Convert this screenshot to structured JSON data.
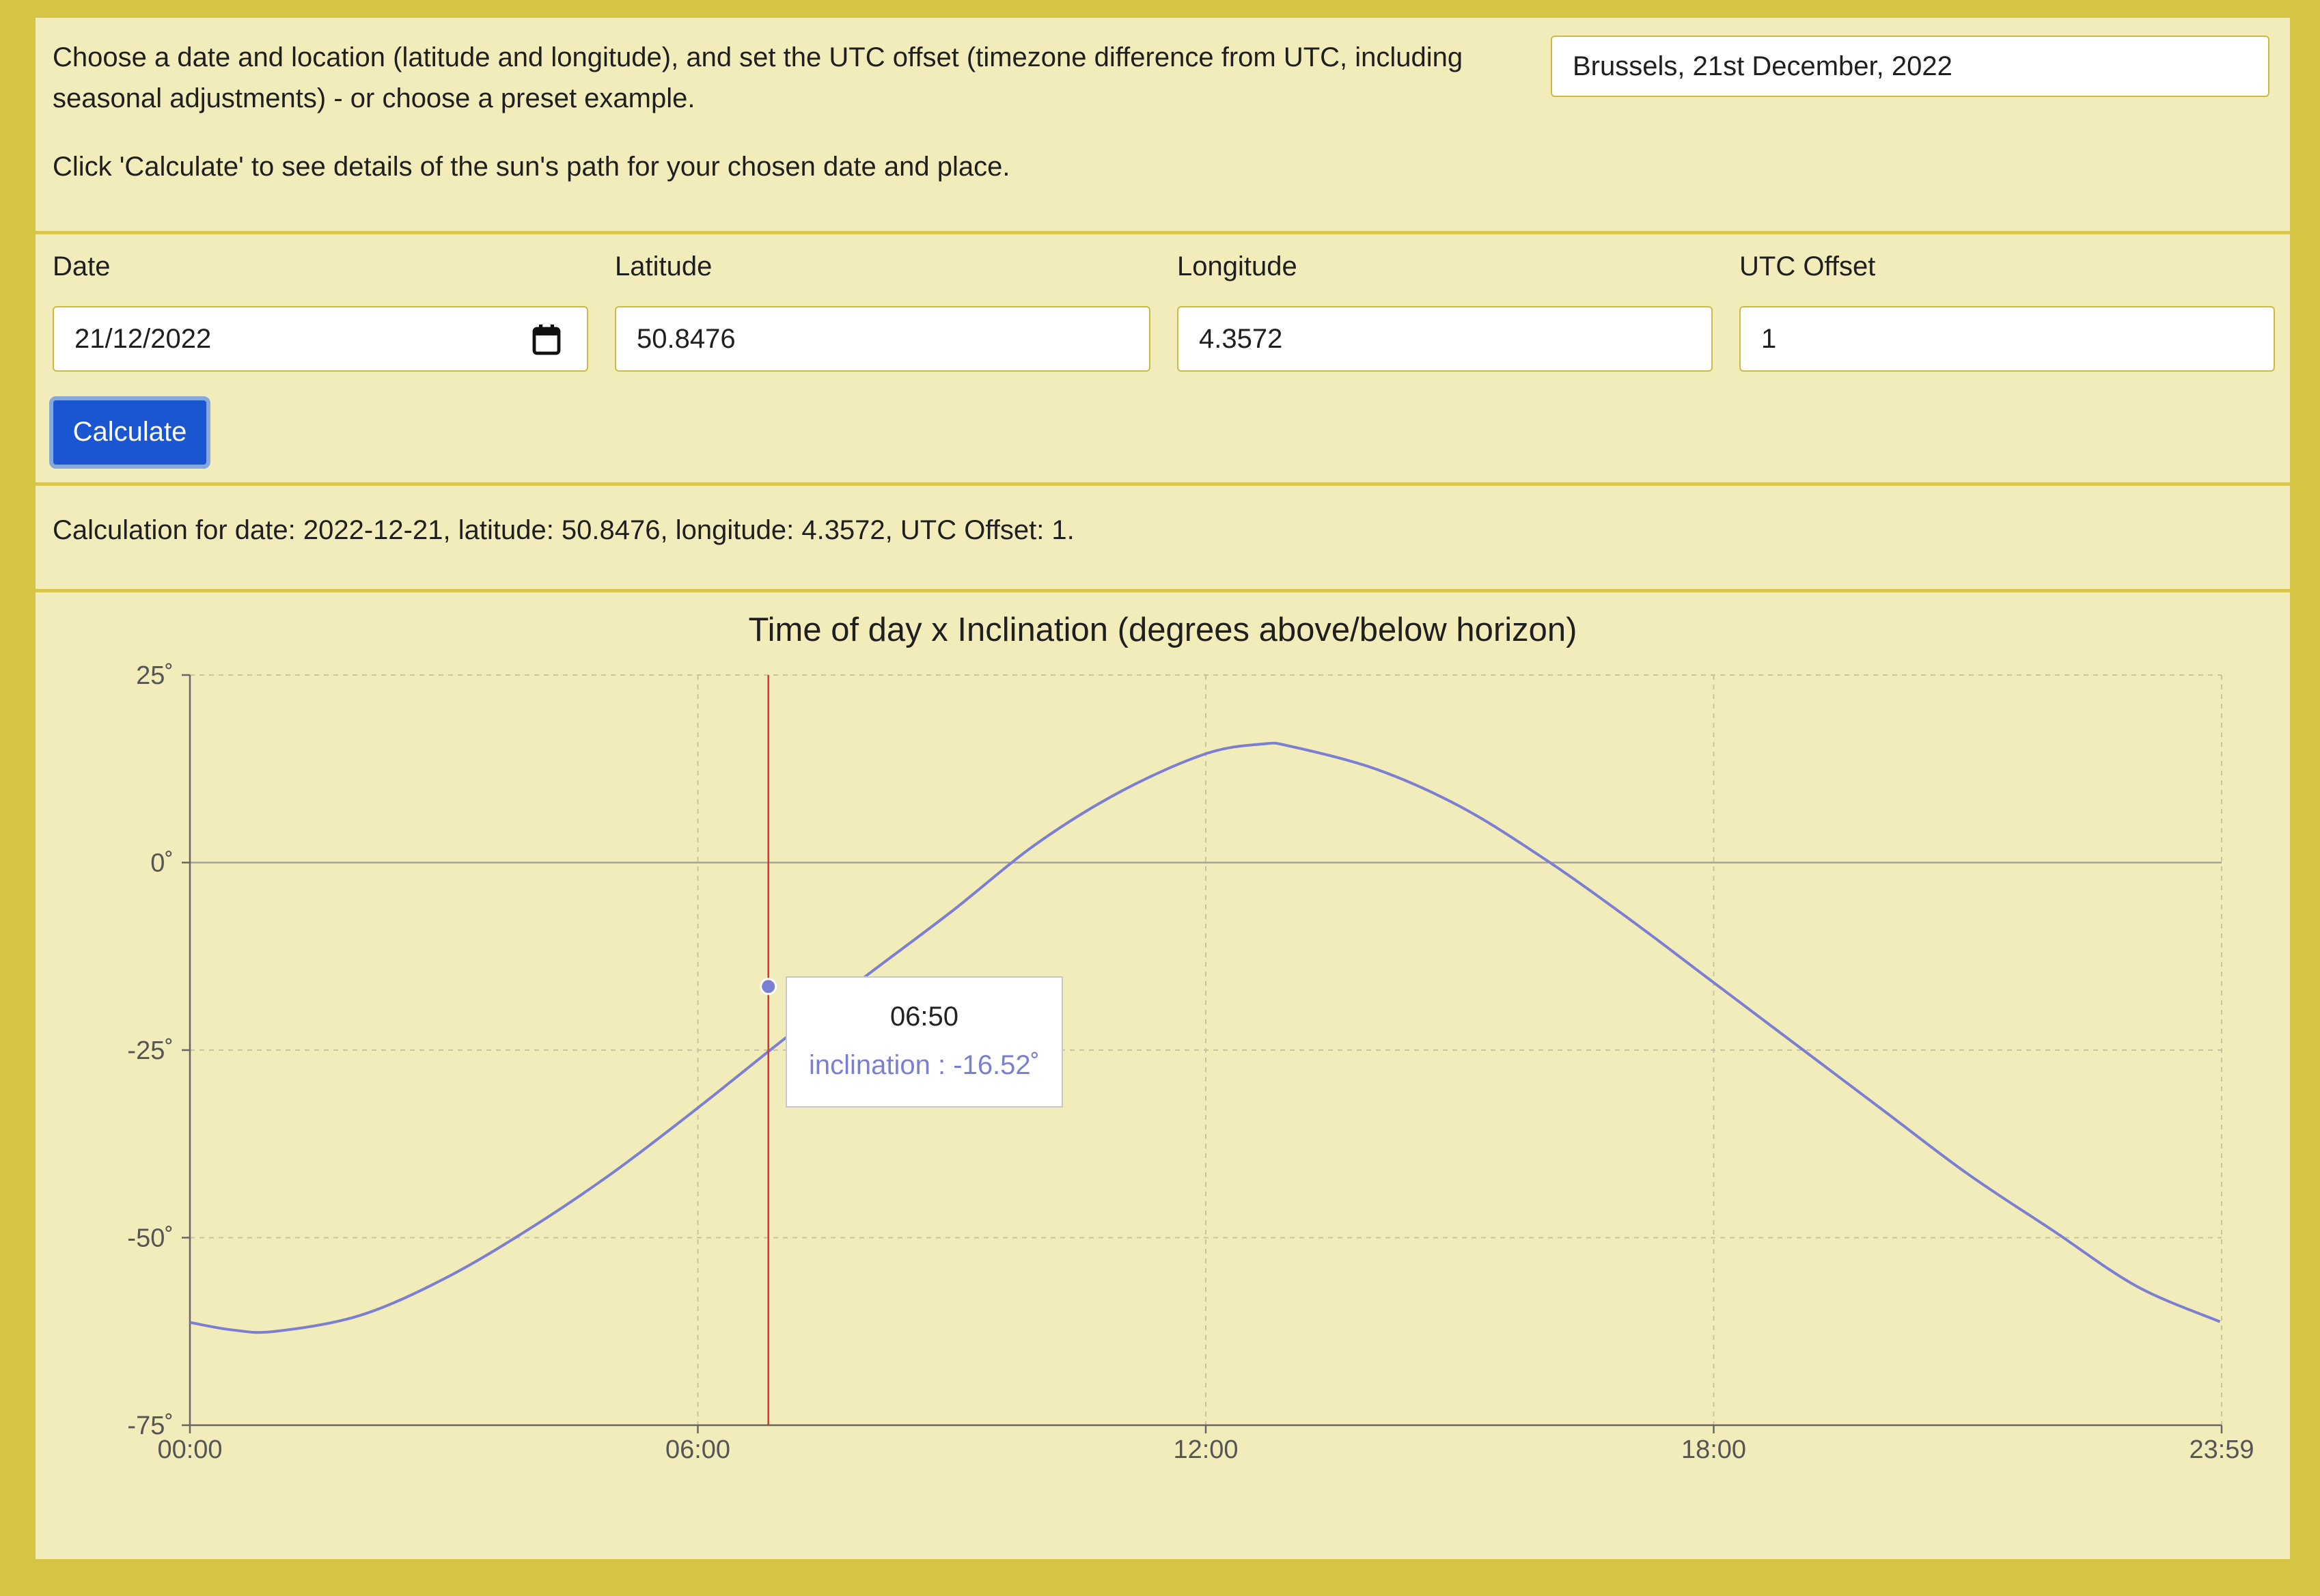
{
  "intro": {
    "line1": "Choose a date and location (latitude and longitude), and set the UTC offset (timezone difference from UTC, including seasonal adjustments) - or choose a preset example.",
    "line2": "Click 'Calculate' to see details of the sun's path for your chosen date and place."
  },
  "preset": {
    "selected": "Brussels, 21st December, 2022"
  },
  "form": {
    "date_label": "Date",
    "date_value": "21/12/2022",
    "lat_label": "Latitude",
    "lat_value": "50.8476",
    "lon_label": "Longitude",
    "lon_value": "4.3572",
    "utc_label": "UTC Offset",
    "utc_value": "1",
    "calculate_label": "Calculate"
  },
  "summary": "Calculation for date: 2022-12-21, latitude: 50.8476, longitude: 4.3572, UTC Offset: 1.",
  "tooltip": {
    "time": "06:50",
    "series_label": "inclination : -16.52˚"
  },
  "colors": {
    "page_border": "#d6c544",
    "panel": "#f2ecba",
    "button": "#1a56d2",
    "series": "#7b7fd1",
    "cursor": "#e03030"
  },
  "chart_data": {
    "type": "line",
    "title": "Time of day x Inclination (degrees above/below horizon)",
    "xlabel": "",
    "ylabel": "",
    "x_ticks": [
      "00:00",
      "06:00",
      "12:00",
      "18:00",
      "23:59"
    ],
    "y_ticks": [
      "25˚",
      "0˚",
      "-25˚",
      "-50˚",
      "-75˚"
    ],
    "xlim": [
      0,
      24
    ],
    "ylim": [
      -75,
      25
    ],
    "grid": true,
    "cursor_x": 6.833,
    "series": [
      {
        "x": [
          0,
          0.5,
          1,
          2,
          3,
          4,
          5,
          6,
          6.833,
          7,
          8,
          9,
          10,
          11,
          12,
          12.67,
          13,
          14,
          15,
          16,
          17,
          18,
          19,
          20,
          21,
          22,
          23,
          23.98
        ],
        "y": [
          -61.3,
          -62.3,
          -62.5,
          -60.4,
          -55.5,
          -48.9,
          -41.3,
          -32.7,
          -16.52,
          -23.7,
          -15,
          -6.5,
          2.5,
          9.5,
          14.5,
          15.8,
          15.5,
          12.5,
          7.5,
          0.5,
          -7.5,
          -16,
          -24.5,
          -33,
          -41.5,
          -49,
          -56.5,
          -61.2
        ]
      }
    ]
  }
}
